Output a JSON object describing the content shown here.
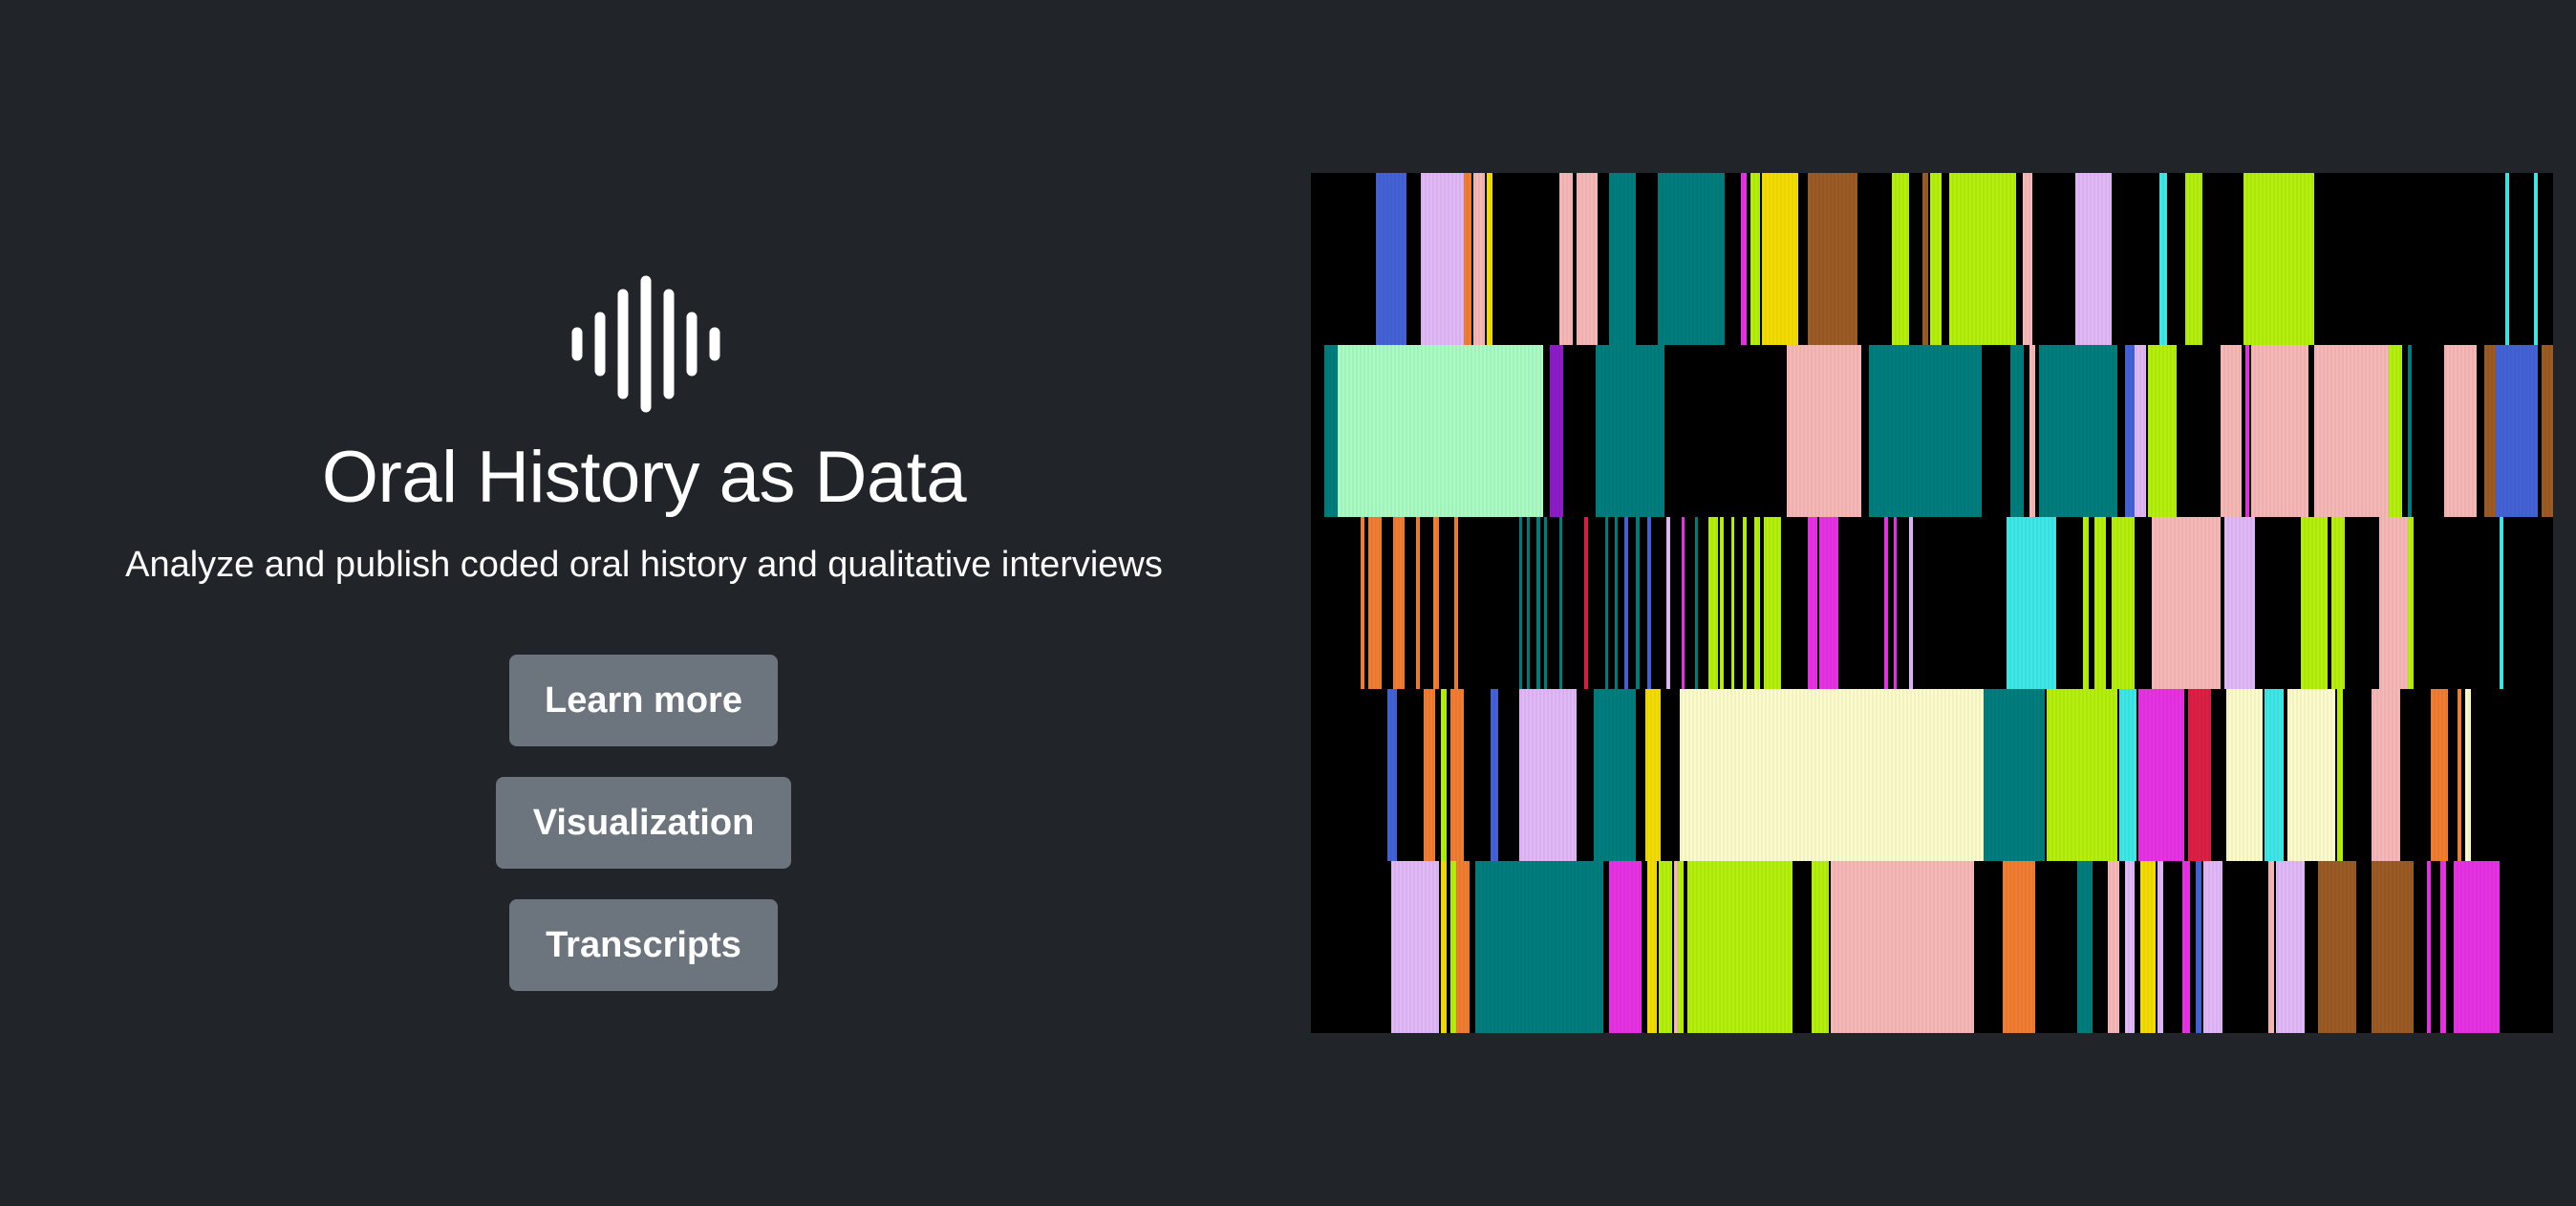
{
  "hero": {
    "title": "Oral History as Data",
    "subtitle": "Analyze and publish coded oral history and qualitative interviews",
    "logo_icon": "soundwave-icon"
  },
  "buttons": {
    "learn_more": "Learn more",
    "visualization": "Visualization",
    "transcripts": "Transcripts"
  },
  "colors": {
    "background": "#212429",
    "button": "#6c757d",
    "text": "#ffffff"
  },
  "visualization": {
    "description": "code-stripe-pattern",
    "rows": 5,
    "palette": [
      "#000000",
      "#4362d6",
      "#e0b8f7",
      "#f07d32",
      "#f6b8b6",
      "#007d7d",
      "#e632e3",
      "#f3dc00",
      "#9b5b25",
      "#b4f00c",
      "#3ee8e6",
      "#a9fbc3",
      "#8c1ec8",
      "#dc1f45",
      "#fcfbcc"
    ]
  }
}
